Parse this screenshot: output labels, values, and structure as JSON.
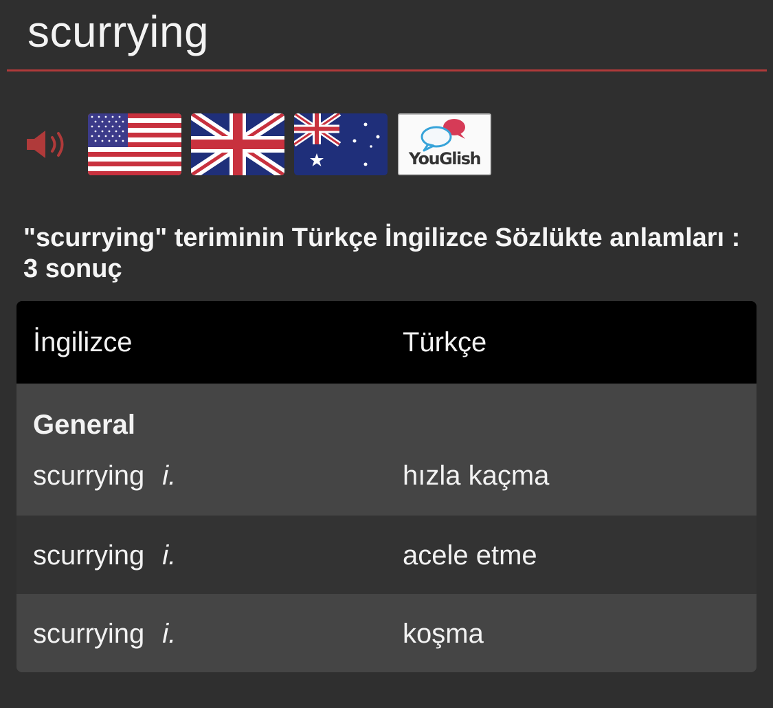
{
  "header": {
    "search_term": "scurrying"
  },
  "pronunciation": {
    "speaker_icon": "speaker-icon",
    "accent_color": "#b03a3a",
    "flags": [
      {
        "icon": "us-flag-icon"
      },
      {
        "icon": "uk-flag-icon"
      },
      {
        "icon": "au-flag-icon"
      }
    ],
    "youglish_label": "YouGlish"
  },
  "results": {
    "heading": "\"scurrying\" teriminin Türkçe İngilizce Sözlükte anlamları : 3 sonuç"
  },
  "table": {
    "headers": {
      "english": "İngilizce",
      "turkish": "Türkçe"
    },
    "category": "General",
    "rows": [
      {
        "term": "scurrying",
        "pos": "i.",
        "translation": "hızla kaçma"
      },
      {
        "term": "scurrying",
        "pos": "i.",
        "translation": "acele etme"
      },
      {
        "term": "scurrying",
        "pos": "i.",
        "translation": "koşma"
      }
    ]
  }
}
